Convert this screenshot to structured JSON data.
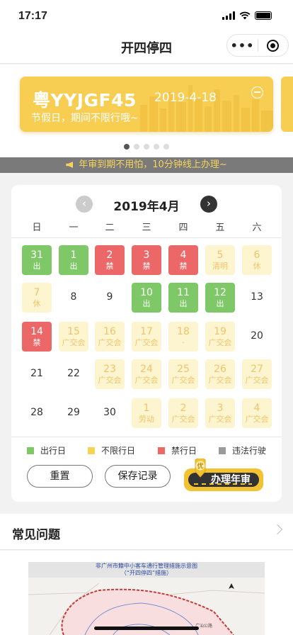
{
  "status_bar": {
    "time": "17:17"
  },
  "nav": {
    "title": "开四停四",
    "more": "•••"
  },
  "card": {
    "plate": "粤YYJGF45",
    "date": "2019-4-18",
    "note": "节假日，期间不限行哦~"
  },
  "notice": "年审到期不用怕，10分钟线上办理~",
  "calendar": {
    "month": "2019年4月",
    "weekdays": [
      "日",
      "一",
      "二",
      "三",
      "四",
      "五",
      "六"
    ],
    "weeks": [
      [
        {
          "d": "31",
          "s": "go",
          "t": "出"
        },
        {
          "d": "1",
          "s": "go",
          "t": "出"
        },
        {
          "d": "2",
          "s": "ban",
          "t": "禁"
        },
        {
          "d": "3",
          "s": "ban",
          "t": "禁"
        },
        {
          "d": "4",
          "s": "ban",
          "t": "禁"
        },
        {
          "d": "5",
          "s": "free",
          "t": "清明"
        },
        {
          "d": "6",
          "s": "free",
          "t": "休"
        }
      ],
      [
        {
          "d": "7",
          "s": "free",
          "t": "休"
        },
        {
          "d": "8",
          "s": "plain",
          "t": ""
        },
        {
          "d": "9",
          "s": "plain",
          "t": ""
        },
        {
          "d": "10",
          "s": "go",
          "t": "出"
        },
        {
          "d": "11",
          "s": "go",
          "t": "出"
        },
        {
          "d": "12",
          "s": "go",
          "t": "出"
        },
        {
          "d": "13",
          "s": "plain",
          "t": ""
        }
      ],
      [
        {
          "d": "14",
          "s": "ban",
          "t": "禁"
        },
        {
          "d": "15",
          "s": "free",
          "t": "广交会"
        },
        {
          "d": "16",
          "s": "free",
          "t": "广交会"
        },
        {
          "d": "17",
          "s": "free",
          "t": "广交会"
        },
        {
          "d": "18",
          "s": "free",
          "t": "·"
        },
        {
          "d": "19",
          "s": "free",
          "t": "广交会"
        },
        {
          "d": "20",
          "s": "plain",
          "t": ""
        }
      ],
      [
        {
          "d": "21",
          "s": "plain",
          "t": ""
        },
        {
          "d": "22",
          "s": "plain",
          "t": ""
        },
        {
          "d": "23",
          "s": "free",
          "t": "广交会"
        },
        {
          "d": "24",
          "s": "free",
          "t": "广交会"
        },
        {
          "d": "25",
          "s": "free",
          "t": "广交会"
        },
        {
          "d": "26",
          "s": "free",
          "t": "广交会"
        },
        {
          "d": "27",
          "s": "free",
          "t": "广交会"
        }
      ],
      [
        {
          "d": "28",
          "s": "plain",
          "t": ""
        },
        {
          "d": "29",
          "s": "plain",
          "t": ""
        },
        {
          "d": "30",
          "s": "plain",
          "t": ""
        },
        {
          "d": "1",
          "s": "free",
          "t": "劳动"
        },
        {
          "d": "2",
          "s": "free",
          "t": "广交会"
        },
        {
          "d": "3",
          "s": "free",
          "t": "广交会"
        },
        {
          "d": "4",
          "s": "free",
          "t": "广交会"
        }
      ]
    ]
  },
  "legend": [
    {
      "label": "出行日",
      "color": "#7ec868"
    },
    {
      "label": "不限行日",
      "color": "#f7d358"
    },
    {
      "label": "禁行日",
      "color": "#ec6868"
    },
    {
      "label": "违法行驶",
      "color": "#9a9a9a"
    }
  ],
  "buttons": {
    "reset": "重置",
    "save": "保存记录",
    "annual": "办理年审",
    "badge_icon": "优"
  },
  "faq": {
    "title": "常见问题"
  },
  "map": {
    "title_line1": "非广州市籍中小客车通行管理措施示意图",
    "title_line2": "（“开四停四”措施）",
    "label": "广汕公路"
  }
}
